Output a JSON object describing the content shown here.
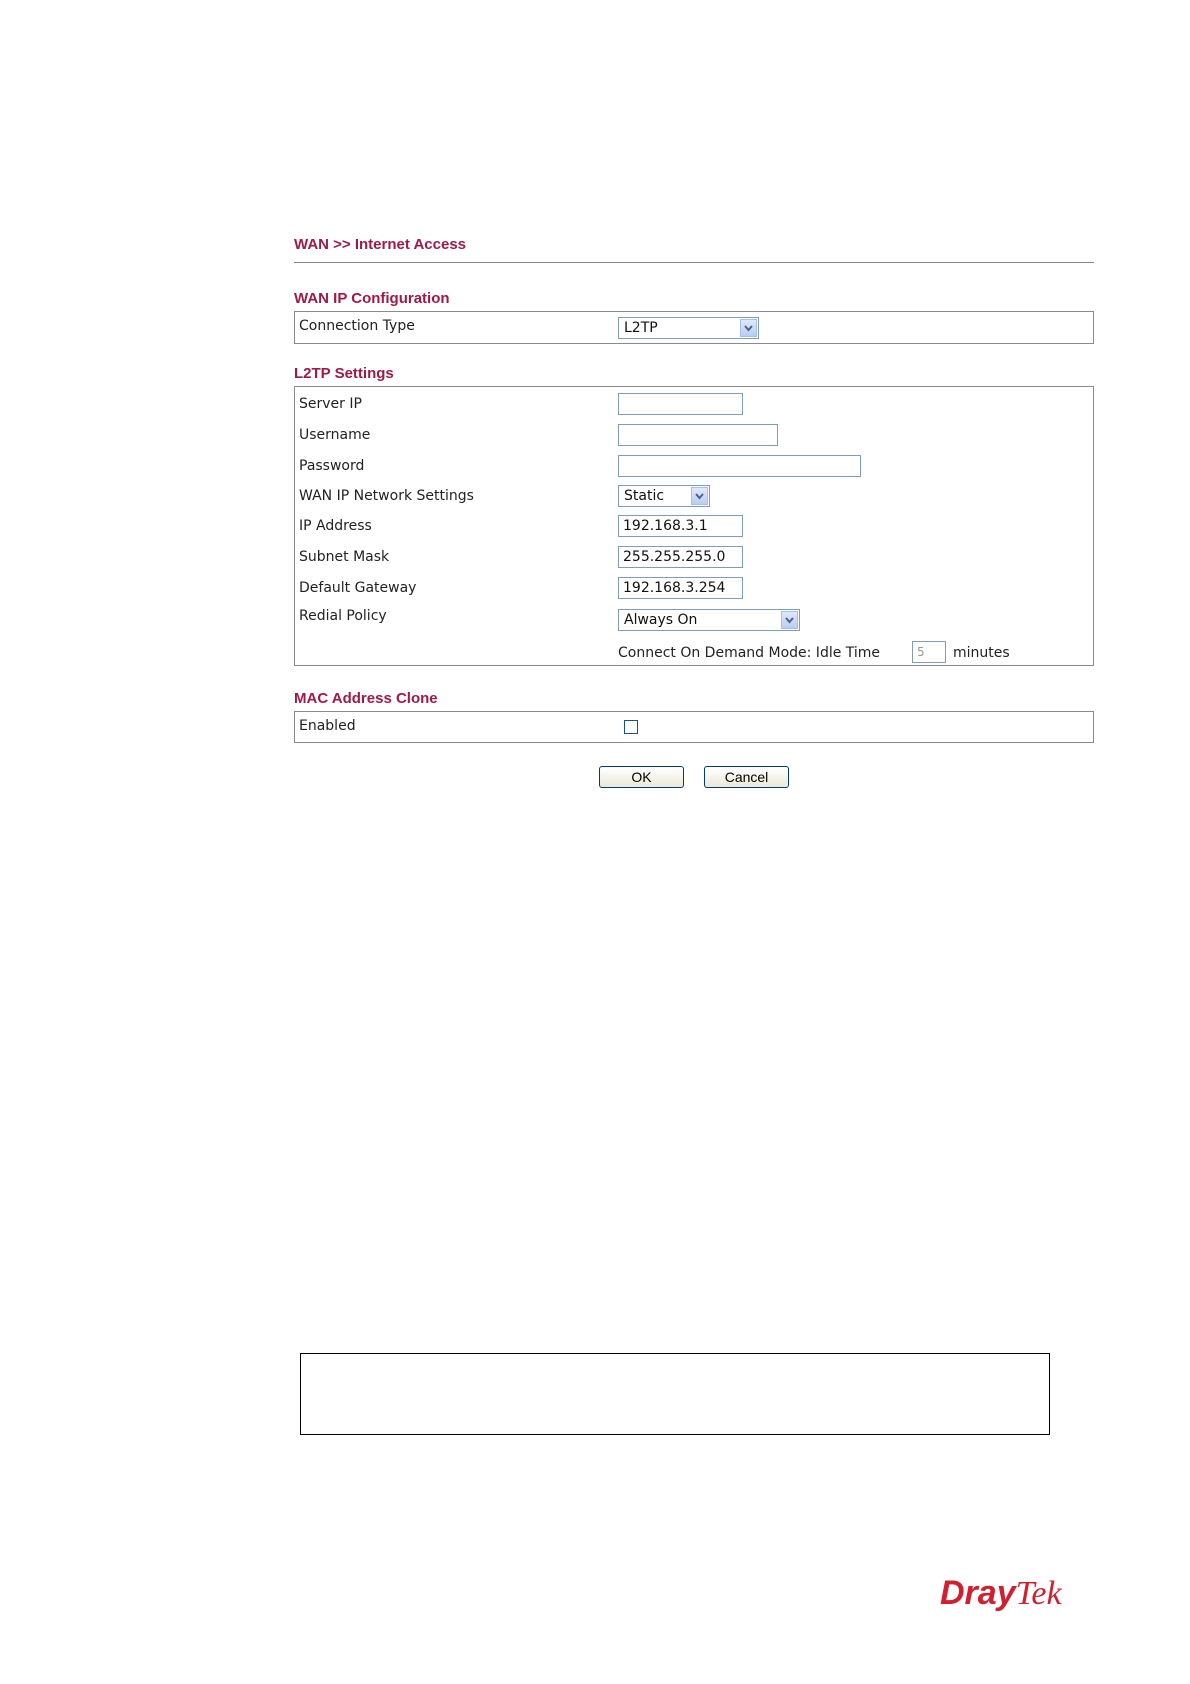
{
  "breadcrumb": "WAN >> Internet Access",
  "wan_ip": {
    "title": "WAN IP Configuration",
    "connection_type_label": "Connection Type",
    "connection_type_value": "L2TP"
  },
  "l2tp": {
    "title": "L2TP Settings",
    "server_ip_label": "Server IP",
    "server_ip_value": "",
    "username_label": "Username",
    "username_value": "",
    "password_label": "Password",
    "password_value": "",
    "network_settings_label": "WAN IP Network Settings",
    "network_settings_value": "Static",
    "ip_address_label": "IP Address",
    "ip_address_value": "192.168.3.1",
    "subnet_mask_label": "Subnet Mask",
    "subnet_mask_value": "255.255.255.0",
    "default_gateway_label": "Default Gateway",
    "default_gateway_value": "192.168.3.254",
    "redial_policy_label": "Redial Policy",
    "redial_policy_value": "Always On",
    "demand_label": "Connect On Demand Mode: Idle Time",
    "idle_time_value": "5",
    "minutes_label": "minutes"
  },
  "mac_clone": {
    "title": "MAC Address Clone",
    "enabled_label": "Enabled",
    "enabled_checked": false
  },
  "buttons": {
    "ok": "OK",
    "cancel": "Cancel"
  },
  "logo": {
    "part1": "Dray",
    "part2": "Tek",
    "color": "#d0202e"
  },
  "colors": {
    "section_title": "#a0194b",
    "field_border": "#7f9db9"
  }
}
